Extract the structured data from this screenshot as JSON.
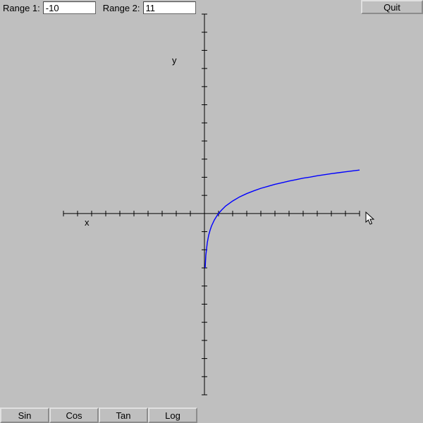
{
  "toolbar": {
    "range1_label": "Range 1:",
    "range1_value": "-10",
    "range2_label": "Range 2:",
    "range2_value": "11",
    "quit_label": "Quit"
  },
  "functions": {
    "sin_label": "Sin",
    "cos_label": "Cos",
    "tan_label": "Tan",
    "log_label": "Log"
  },
  "axes": {
    "x_label": "x",
    "y_label": "y"
  },
  "chart_data": {
    "type": "line",
    "title": "",
    "xlabel": "x",
    "ylabel": "y",
    "xlim": [
      -10,
      11
    ],
    "ylim": [
      -10,
      11
    ],
    "x_ticks": [
      -10,
      -9,
      -8,
      -7,
      -6,
      -5,
      -4,
      -3,
      -2,
      -1,
      0,
      1,
      2,
      3,
      4,
      5,
      6,
      7,
      8,
      9,
      10,
      11
    ],
    "y_ticks": [
      -10,
      -9,
      -8,
      -7,
      -6,
      -5,
      -4,
      -3,
      -2,
      -1,
      0,
      1,
      2,
      3,
      4,
      5,
      6,
      7,
      8,
      9,
      10,
      11
    ],
    "series": [
      {
        "name": "log",
        "function": "ln(x)",
        "x": [
          0.05,
          0.1,
          0.2,
          0.3,
          0.4,
          0.5,
          0.7,
          0.9,
          1,
          1.2,
          1.5,
          2,
          2.5,
          3,
          3.5,
          4,
          4.5,
          5,
          5.5,
          6,
          6.5,
          7,
          7.5,
          8,
          8.5,
          9,
          9.5,
          10,
          10.5,
          11
        ],
        "values": [
          -3.0,
          -2.3,
          -1.61,
          -1.2,
          -0.92,
          -0.69,
          -0.36,
          -0.11,
          0.0,
          0.18,
          0.41,
          0.69,
          0.92,
          1.1,
          1.25,
          1.39,
          1.5,
          1.61,
          1.7,
          1.79,
          1.87,
          1.95,
          2.01,
          2.08,
          2.14,
          2.2,
          2.25,
          2.3,
          2.35,
          2.4
        ]
      }
    ]
  },
  "colors": {
    "curve": "#0000ff",
    "axis": "#000000",
    "bg": "#bfbfbf"
  }
}
